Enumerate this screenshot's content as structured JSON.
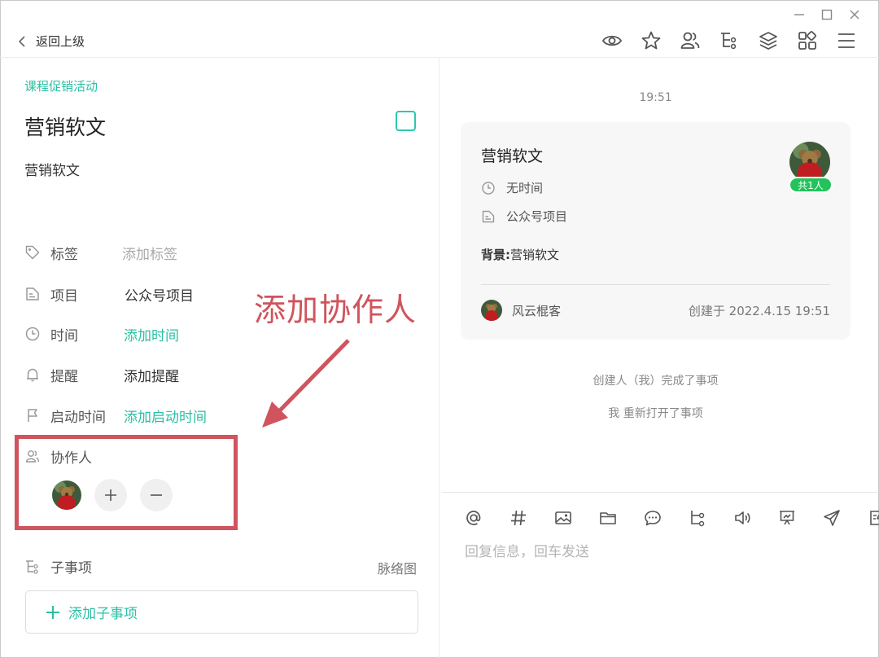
{
  "header": {
    "back_label": "返回上级"
  },
  "window_controls": [
    "minimize-icon",
    "maximize-icon",
    "close-icon"
  ],
  "toolbar": {
    "icons": [
      "eye-icon",
      "star-icon",
      "users-icon",
      "tree-icon",
      "layers-icon",
      "apps-icon",
      "menu-icon"
    ]
  },
  "task": {
    "breadcrumb": "课程促销活动",
    "title": "营销软文",
    "description": "营销软文",
    "done": false
  },
  "properties": {
    "tags": {
      "label": "标签",
      "value": "添加标签"
    },
    "project": {
      "label": "项目",
      "value": "公众号项目"
    },
    "time": {
      "label": "时间",
      "value": "添加时间"
    },
    "reminder": {
      "label": "提醒",
      "value": "添加提醒"
    },
    "start_time": {
      "label": "启动时间",
      "value": "添加启动时间"
    },
    "collaborators": {
      "label": "协作人"
    }
  },
  "subitems": {
    "label": "子事项",
    "network_link": "脉络图",
    "add_label": "添加子事项"
  },
  "annotation": {
    "text": "添加协作人",
    "color": "#d0545d"
  },
  "feed": {
    "timestamp": "19:51",
    "card": {
      "title": "营销软文",
      "time": "无时间",
      "project": "公众号项目",
      "background_label": "背景:",
      "background_value": "营销软文",
      "badge": "共1人",
      "creator": "风云棍客",
      "created": "创建于 2022.4.15 19:51"
    },
    "activities": [
      "创建人（我）完成了事项",
      "我 重新打开了事项"
    ]
  },
  "composer": {
    "placeholder": "回复信息，回车发送",
    "tools": [
      "at-icon",
      "hash-icon",
      "image-icon",
      "folder-icon",
      "chat-bubble-icon",
      "flow-icon",
      "speaker-icon",
      "presentation-icon",
      "send-icon",
      "edit-icon"
    ]
  },
  "colors": {
    "accent": "#2bbfa3",
    "badge": "#22c35a",
    "annotation": "#d0545d"
  }
}
